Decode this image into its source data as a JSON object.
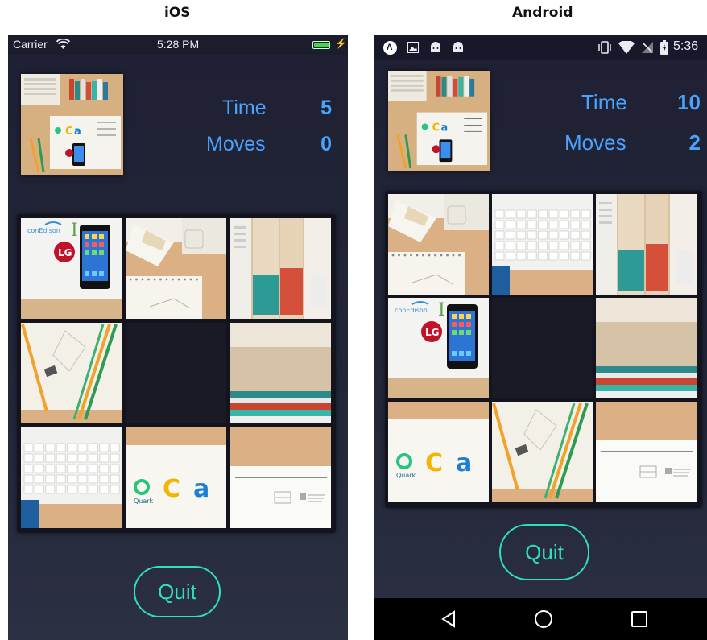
{
  "headers": {
    "ios": "iOS",
    "android": "Android"
  },
  "ios": {
    "status": {
      "carrier": "Carrier",
      "time": "5:28 PM"
    },
    "stats": {
      "time_label": "Time",
      "time_value": "5",
      "moves_label": "Moves",
      "moves_value": "0"
    },
    "quit_label": "Quit",
    "tiles": [
      {
        "name": "tile-phone-lg"
      },
      {
        "name": "tile-notepad-desk"
      },
      {
        "name": "tile-books-stack"
      },
      {
        "name": "tile-pencils"
      },
      {
        "name": "empty-slot"
      },
      {
        "name": "tile-books-side"
      },
      {
        "name": "tile-keyboard"
      },
      {
        "name": "tile-logos"
      },
      {
        "name": "tile-paper-corner"
      }
    ]
  },
  "android": {
    "status": {
      "time": "5:36"
    },
    "stats": {
      "time_label": "Time",
      "time_value": "10",
      "moves_label": "Moves",
      "moves_value": "2"
    },
    "quit_label": "Quit",
    "tiles": [
      {
        "name": "tile-notepad-desk"
      },
      {
        "name": "tile-keyboard"
      },
      {
        "name": "tile-books-stack"
      },
      {
        "name": "tile-phone-lg"
      },
      {
        "name": "empty-slot"
      },
      {
        "name": "tile-books-side"
      },
      {
        "name": "tile-logos"
      },
      {
        "name": "tile-pencils"
      },
      {
        "name": "tile-paper-corner"
      }
    ],
    "nav": {
      "back": "back-icon",
      "home": "home-icon",
      "recents": "recents-icon"
    }
  },
  "tile_text": {
    "brand": "conEdison",
    "lg": "LG",
    "quark": "Quark",
    "c": "C",
    "a": "a"
  },
  "colors": {
    "accent_blue": "#4aa3ff",
    "accent_teal": "#2ee0bf",
    "background": "#1f2033"
  }
}
